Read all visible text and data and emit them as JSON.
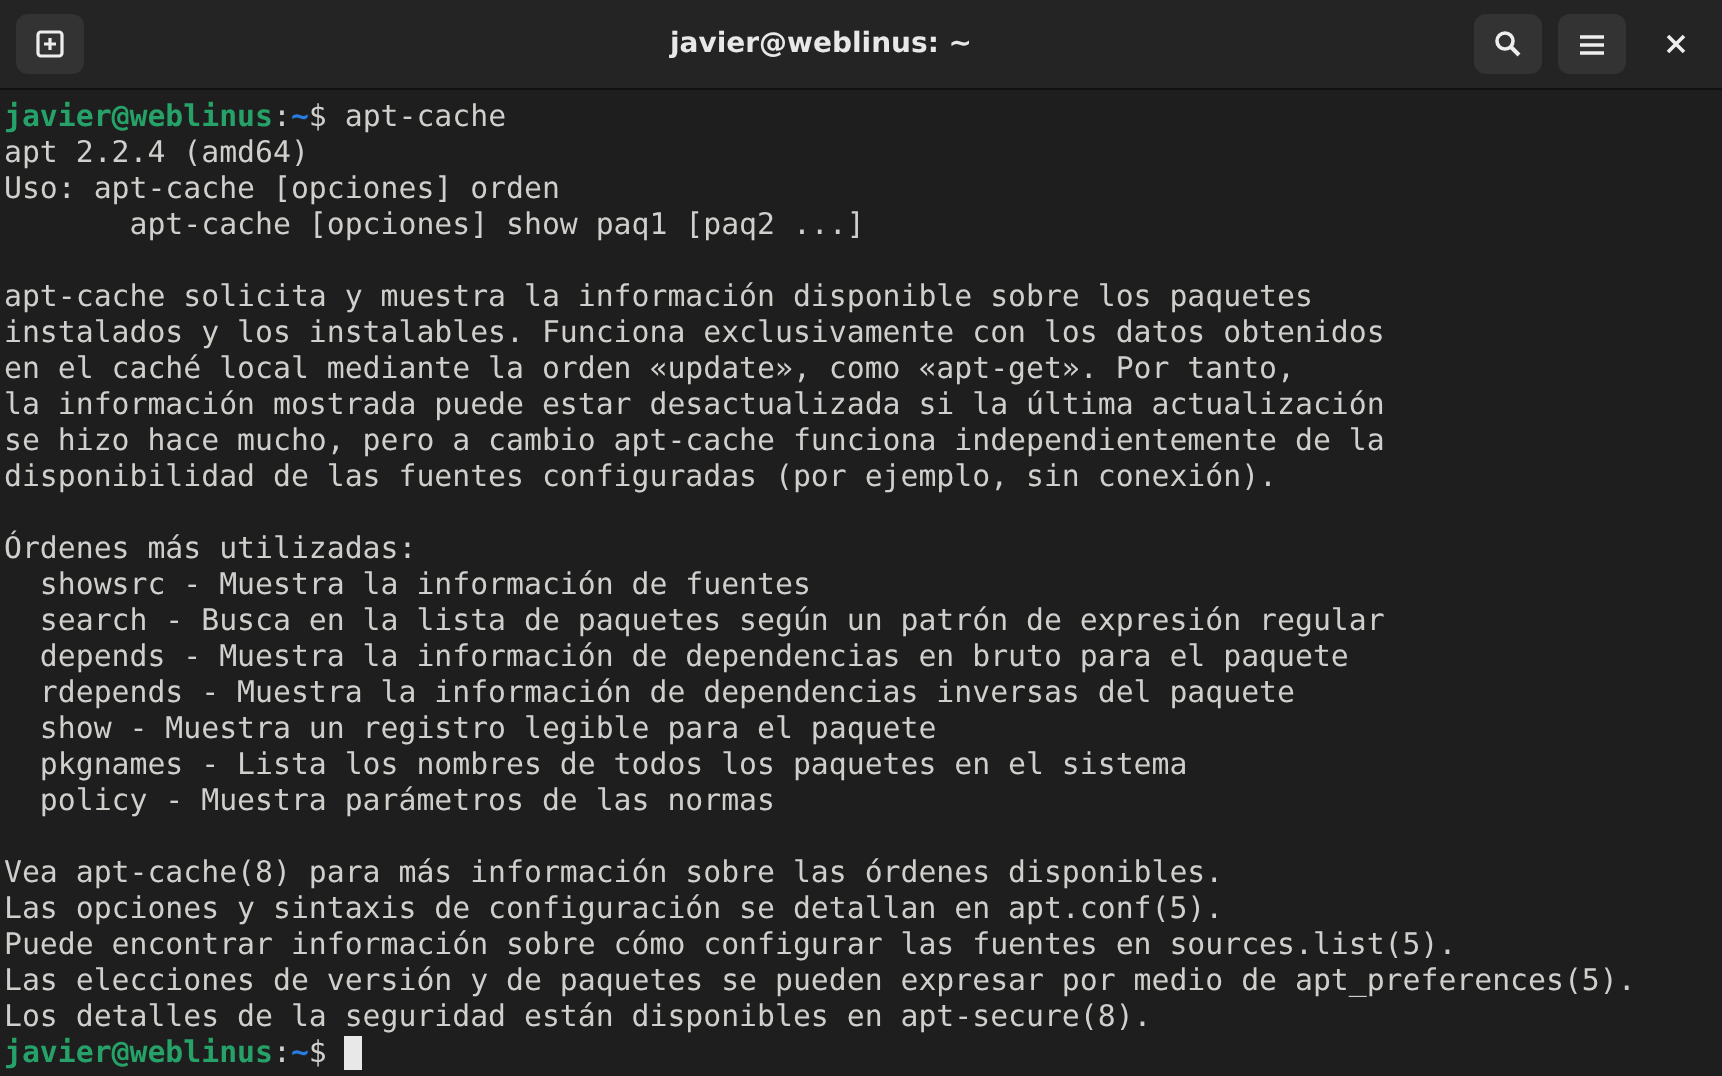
{
  "window": {
    "title": "javier@weblinus: ~"
  },
  "terminal": {
    "lines": [
      {
        "kind": "prompt",
        "user": "javier@weblinus",
        "separator": ":",
        "path": "~",
        "symbol": "$",
        "command": "apt-cache",
        "cursor": false
      },
      {
        "kind": "output",
        "text": "apt 2.2.4 (amd64)"
      },
      {
        "kind": "output",
        "text": "Uso: apt-cache [opciones] orden"
      },
      {
        "kind": "output",
        "text": "       apt-cache [opciones] show paq1 [paq2 ...]"
      },
      {
        "kind": "blank"
      },
      {
        "kind": "output",
        "text": "apt-cache solicita y muestra la información disponible sobre los paquetes"
      },
      {
        "kind": "output",
        "text": "instalados y los instalables. Funciona exclusivamente con los datos obtenidos"
      },
      {
        "kind": "output",
        "text": "en el caché local mediante la orden «update», como «apt-get». Por tanto,"
      },
      {
        "kind": "output",
        "text": "la información mostrada puede estar desactualizada si la última actualización"
      },
      {
        "kind": "output",
        "text": "se hizo hace mucho, pero a cambio apt-cache funciona independientemente de la"
      },
      {
        "kind": "output",
        "text": "disponibilidad de las fuentes configuradas (por ejemplo, sin conexión)."
      },
      {
        "kind": "blank"
      },
      {
        "kind": "output",
        "text": "Órdenes más utilizadas:"
      },
      {
        "kind": "output",
        "text": "  showsrc - Muestra la información de fuentes"
      },
      {
        "kind": "output",
        "text": "  search - Busca en la lista de paquetes según un patrón de expresión regular"
      },
      {
        "kind": "output",
        "text": "  depends - Muestra la información de dependencias en bruto para el paquete"
      },
      {
        "kind": "output",
        "text": "  rdepends - Muestra la información de dependencias inversas del paquete"
      },
      {
        "kind": "output",
        "text": "  show - Muestra un registro legible para el paquete"
      },
      {
        "kind": "output",
        "text": "  pkgnames - Lista los nombres de todos los paquetes en el sistema"
      },
      {
        "kind": "output",
        "text": "  policy - Muestra parámetros de las normas"
      },
      {
        "kind": "blank"
      },
      {
        "kind": "output",
        "text": "Vea apt-cache(8) para más información sobre las órdenes disponibles."
      },
      {
        "kind": "output",
        "text": "Las opciones y sintaxis de configuración se detallan en apt.conf(5)."
      },
      {
        "kind": "output",
        "text": "Puede encontrar información sobre cómo configurar las fuentes en sources.list(5)."
      },
      {
        "kind": "output",
        "text": "Las elecciones de versión y de paquetes se pueden expresar por medio de apt_preferences(5)."
      },
      {
        "kind": "output",
        "text": "Los detalles de la seguridad están disponibles en apt-secure(8)."
      },
      {
        "kind": "prompt",
        "user": "javier@weblinus",
        "separator": ":",
        "path": "~",
        "symbol": "$",
        "cursor": true
      }
    ]
  }
}
